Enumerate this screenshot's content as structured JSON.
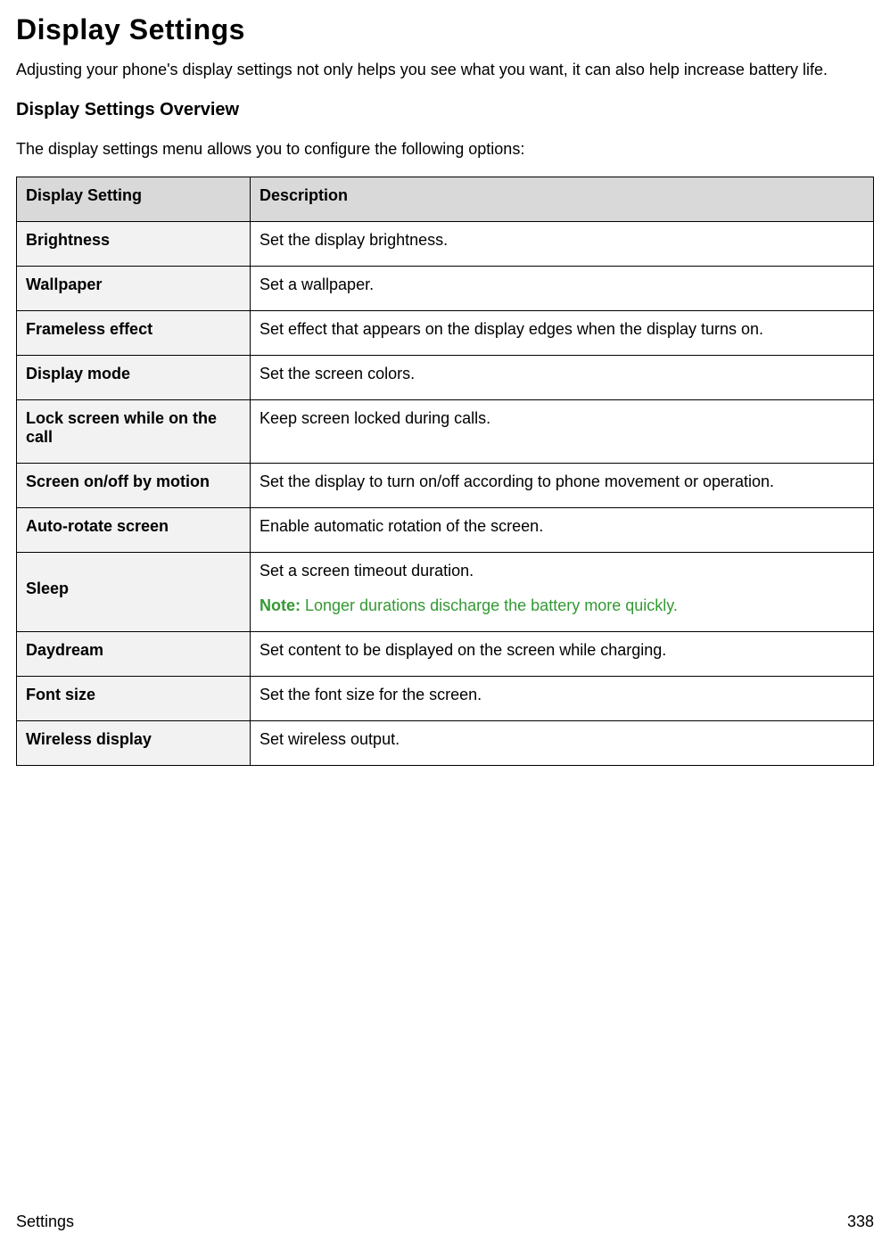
{
  "title": "Display Settings",
  "intro": "Adjusting your phone's display settings not only helps you see what you want, it can also help increase battery life.",
  "overviewHeading": "Display Settings Overview",
  "overviewLead": "The display settings menu allows you to configure the following options:",
  "table": {
    "headers": {
      "setting": "Display Setting",
      "description": "Description"
    },
    "rows": [
      {
        "setting": "Brightness",
        "description": "Set the display brightness."
      },
      {
        "setting": "Wallpaper",
        "description": "Set a wallpaper."
      },
      {
        "setting": "Frameless effect",
        "description": "Set effect that appears on the display edges when the display turns on."
      },
      {
        "setting": "Display mode",
        "description": "Set the screen colors."
      },
      {
        "setting": "Lock screen while on the call",
        "description": "Keep screen locked during calls."
      },
      {
        "setting": "Screen on/off by motion",
        "description": "Set the display to turn on/off according to phone movement or operation."
      },
      {
        "setting": "Auto-rotate screen",
        "description": "Enable automatic rotation of the screen."
      },
      {
        "setting": "Sleep",
        "description": "Set a screen timeout duration.",
        "noteLabel": "Note:",
        "noteText": " Longer durations discharge the battery more quickly."
      },
      {
        "setting": "Daydream",
        "description": "Set content to be displayed on the screen while charging."
      },
      {
        "setting": "Font size",
        "description": "Set the font size for the screen."
      },
      {
        "setting": "Wireless display",
        "description": "Set wireless output."
      }
    ]
  },
  "footer": {
    "section": "Settings",
    "page": "338"
  }
}
